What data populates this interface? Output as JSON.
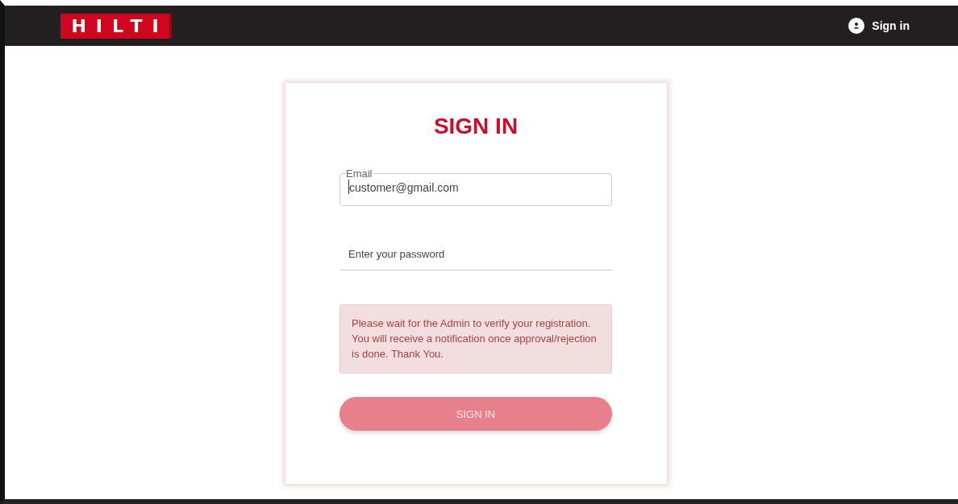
{
  "header": {
    "logo": "HILTI",
    "sign_in_link": "Sign in"
  },
  "form": {
    "title": "SIGN IN",
    "email": {
      "label": "Email",
      "value": "customer@gmail.com"
    },
    "password": {
      "placeholder": "Enter your password"
    },
    "alert": "Please wait for the Admin to verify your registration. You will receive a notification once approval/rejection is done. Thank You.",
    "submit": {
      "label": "SIGN IN",
      "disabled": true
    }
  }
}
